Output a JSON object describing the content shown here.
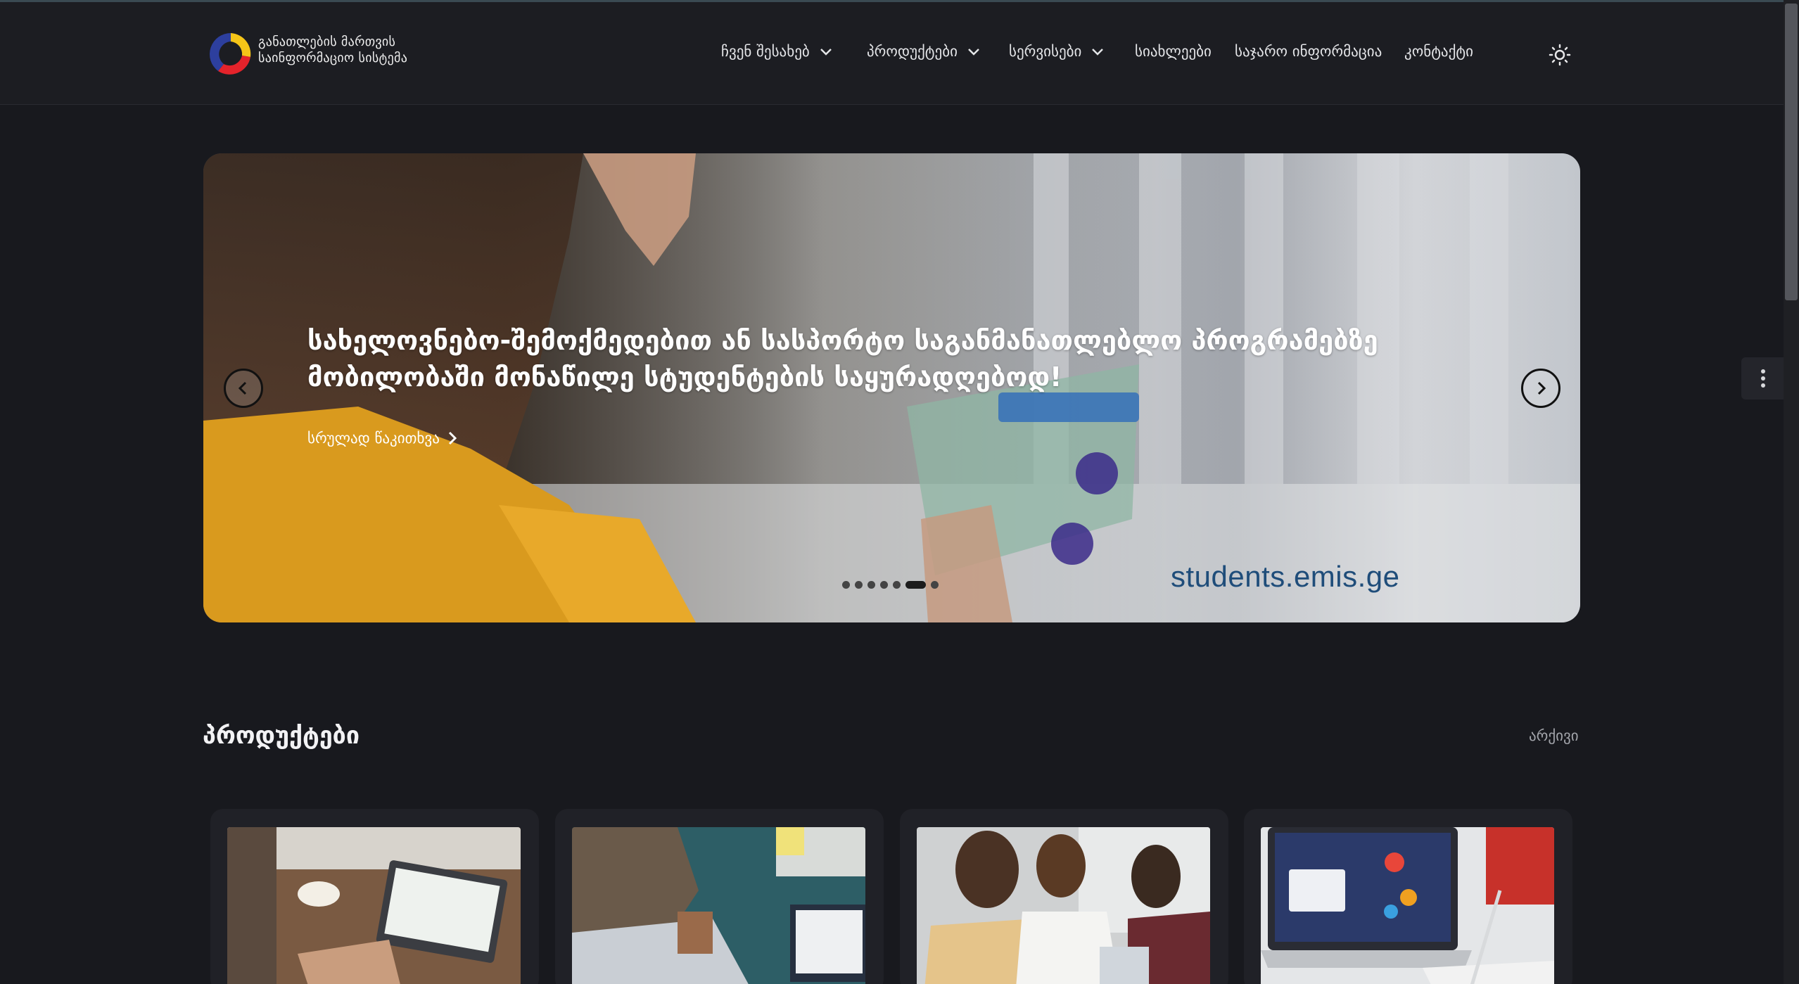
{
  "header": {
    "logo_line1": "განათლების მართვის",
    "logo_line2": "საინფორმაციო სისტემა",
    "nav": [
      {
        "label": "ჩვენ შესახებ",
        "has_dropdown": true
      },
      {
        "label": "პროდუქტები",
        "has_dropdown": true
      },
      {
        "label": "სერვისები",
        "has_dropdown": true
      },
      {
        "label": "სიახლეები",
        "has_dropdown": false
      },
      {
        "label": "საჯარო ინფორმაცია",
        "has_dropdown": false
      },
      {
        "label": "კონტაქტი",
        "has_dropdown": false
      }
    ],
    "theme_icon": "sun-icon"
  },
  "hero": {
    "title": "სახელოვნებო-შემოქმედებით ან სასპორტო საგანმანათლებლო პროგრამებზე მობილობაში მონაწილე სტუდენტების საყურადღებოდ!",
    "read_more": "სრულად წაკითხვა",
    "watermark": "students.emis.ge",
    "slide_count": 7,
    "active_slide": 6
  },
  "products": {
    "title": "პროდუქტები",
    "archive": "არქივი",
    "cards": [
      {
        "image": "laptop-spreadsheet-photo"
      },
      {
        "image": "student-laptop-photo"
      },
      {
        "image": "students-group-photo"
      },
      {
        "image": "laptop-tablet-photo"
      }
    ]
  },
  "colors": {
    "background": "#18191e",
    "header": "#1c1d22",
    "card": "#202127",
    "accent_blue": "#1f4d7a"
  }
}
